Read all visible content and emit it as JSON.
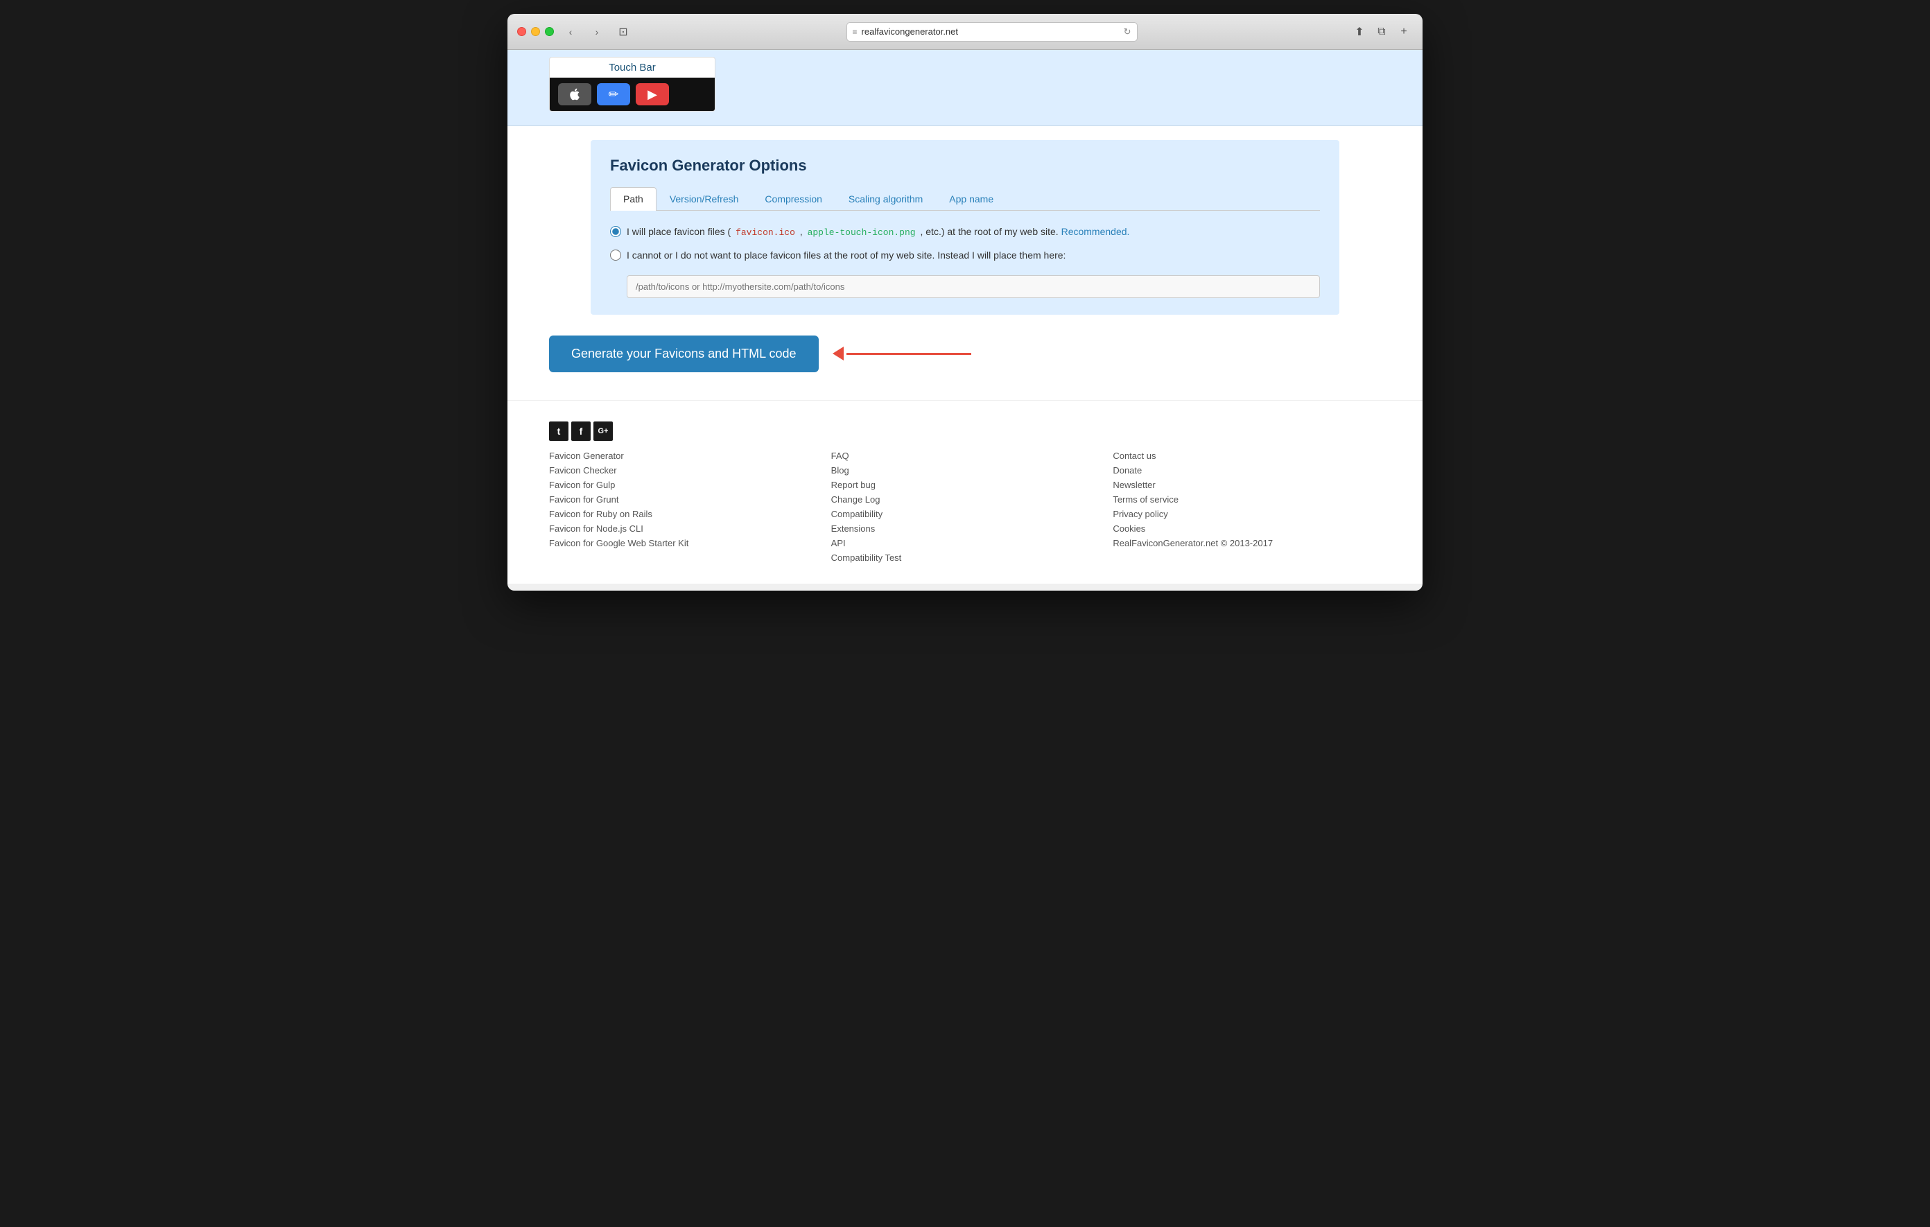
{
  "browser": {
    "url": "realfavicongenerator.net",
    "back_btn": "‹",
    "forward_btn": "›"
  },
  "touch_bar": {
    "label": "Touch Bar",
    "icons": [
      {
        "name": "apple",
        "symbol": ""
      },
      {
        "name": "pencil",
        "symbol": "✏"
      },
      {
        "name": "youtube",
        "symbol": "▶"
      }
    ]
  },
  "options": {
    "title": "Favicon Generator Options",
    "tabs": [
      {
        "label": "Path",
        "active": true
      },
      {
        "label": "Version/Refresh",
        "active": false
      },
      {
        "label": "Compression",
        "active": false
      },
      {
        "label": "Scaling algorithm",
        "active": false
      },
      {
        "label": "App name",
        "active": false
      }
    ],
    "radio_options": [
      {
        "id": "root",
        "checked": true,
        "text_before": "I will place favicon files (",
        "code1": "favicon.ico",
        "separator": " , ",
        "code2": "apple-touch-icon.png",
        "text_after": " , etc.) at the root of my web site.",
        "recommended": " Recommended."
      },
      {
        "id": "custom",
        "checked": false,
        "text": "I cannot or I do not want to place favicon files at the root of my web site. Instead I will place them here:"
      }
    ],
    "path_input_placeholder": "/path/to/icons or http://myothersite.com/path/to/icons"
  },
  "generate": {
    "button_label": "Generate your Favicons and HTML code"
  },
  "footer": {
    "social_icons": [
      {
        "name": "twitter",
        "label": "t"
      },
      {
        "name": "facebook",
        "label": "f"
      },
      {
        "name": "google-plus",
        "label": "G+"
      }
    ],
    "col1_links": [
      "Favicon Generator",
      "Favicon Checker",
      "Favicon for Gulp",
      "Favicon for Grunt",
      "Favicon for Ruby on Rails",
      "Favicon for Node.js CLI",
      "Favicon for Google Web Starter Kit"
    ],
    "col2_links": [
      "FAQ",
      "Blog",
      "Report bug",
      "Change Log",
      "Compatibility",
      "Extensions",
      "API",
      "Compatibility Test"
    ],
    "col3_links": [
      "Contact us",
      "Donate",
      "Newsletter",
      "Terms of service",
      "Privacy policy",
      "Cookies"
    ],
    "copyright": "RealFaviconGenerator.net © 2013-2017"
  }
}
